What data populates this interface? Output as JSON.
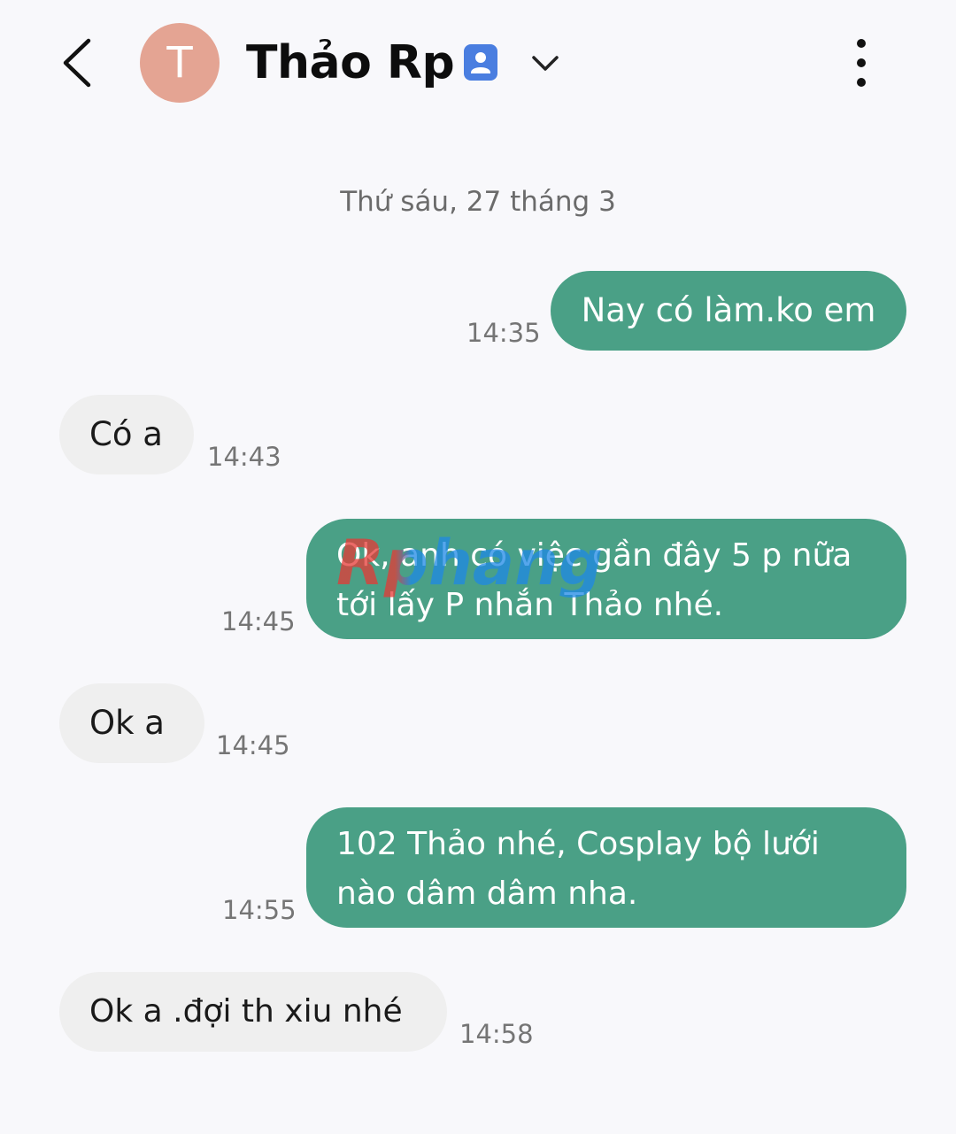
{
  "header": {
    "avatar_letter": "T",
    "contact_name": "Thảo Rp",
    "icons": [
      "back-arrow-icon",
      "contact-card-icon",
      "chevron-down-icon",
      "more-vertical-icon"
    ]
  },
  "date_separator": "Thứ sáu, 27 tháng 3",
  "messages": [
    {
      "direction": "out",
      "lines": [
        "Nay có làm.ko em"
      ],
      "time": "14:35"
    },
    {
      "direction": "in",
      "lines": [
        "Có a"
      ],
      "time": "14:43"
    },
    {
      "direction": "out",
      "lines": [
        "Ok, anh có việc gần đây 5 p nữa",
        "tới lấy P nhắn Thảo nhé."
      ],
      "time": "14:45"
    },
    {
      "direction": "in",
      "lines": [
        "Ok a"
      ],
      "time": "14:45"
    },
    {
      "direction": "out",
      "lines": [
        "102 Thảo nhé, Cosplay bộ lưới",
        "nào dâm dâm nha."
      ],
      "time": "14:55"
    },
    {
      "direction": "in",
      "lines": [
        "Ok a .đợi th xiu nhé"
      ],
      "time": "14:58"
    }
  ],
  "watermark": "Rphang",
  "colors": {
    "background": "#f8f8fb",
    "outgoing_bubble": "#4aa086",
    "incoming_bubble": "#efefef",
    "avatar": "#e4a493",
    "contact_badge": "#4a7ee0"
  }
}
